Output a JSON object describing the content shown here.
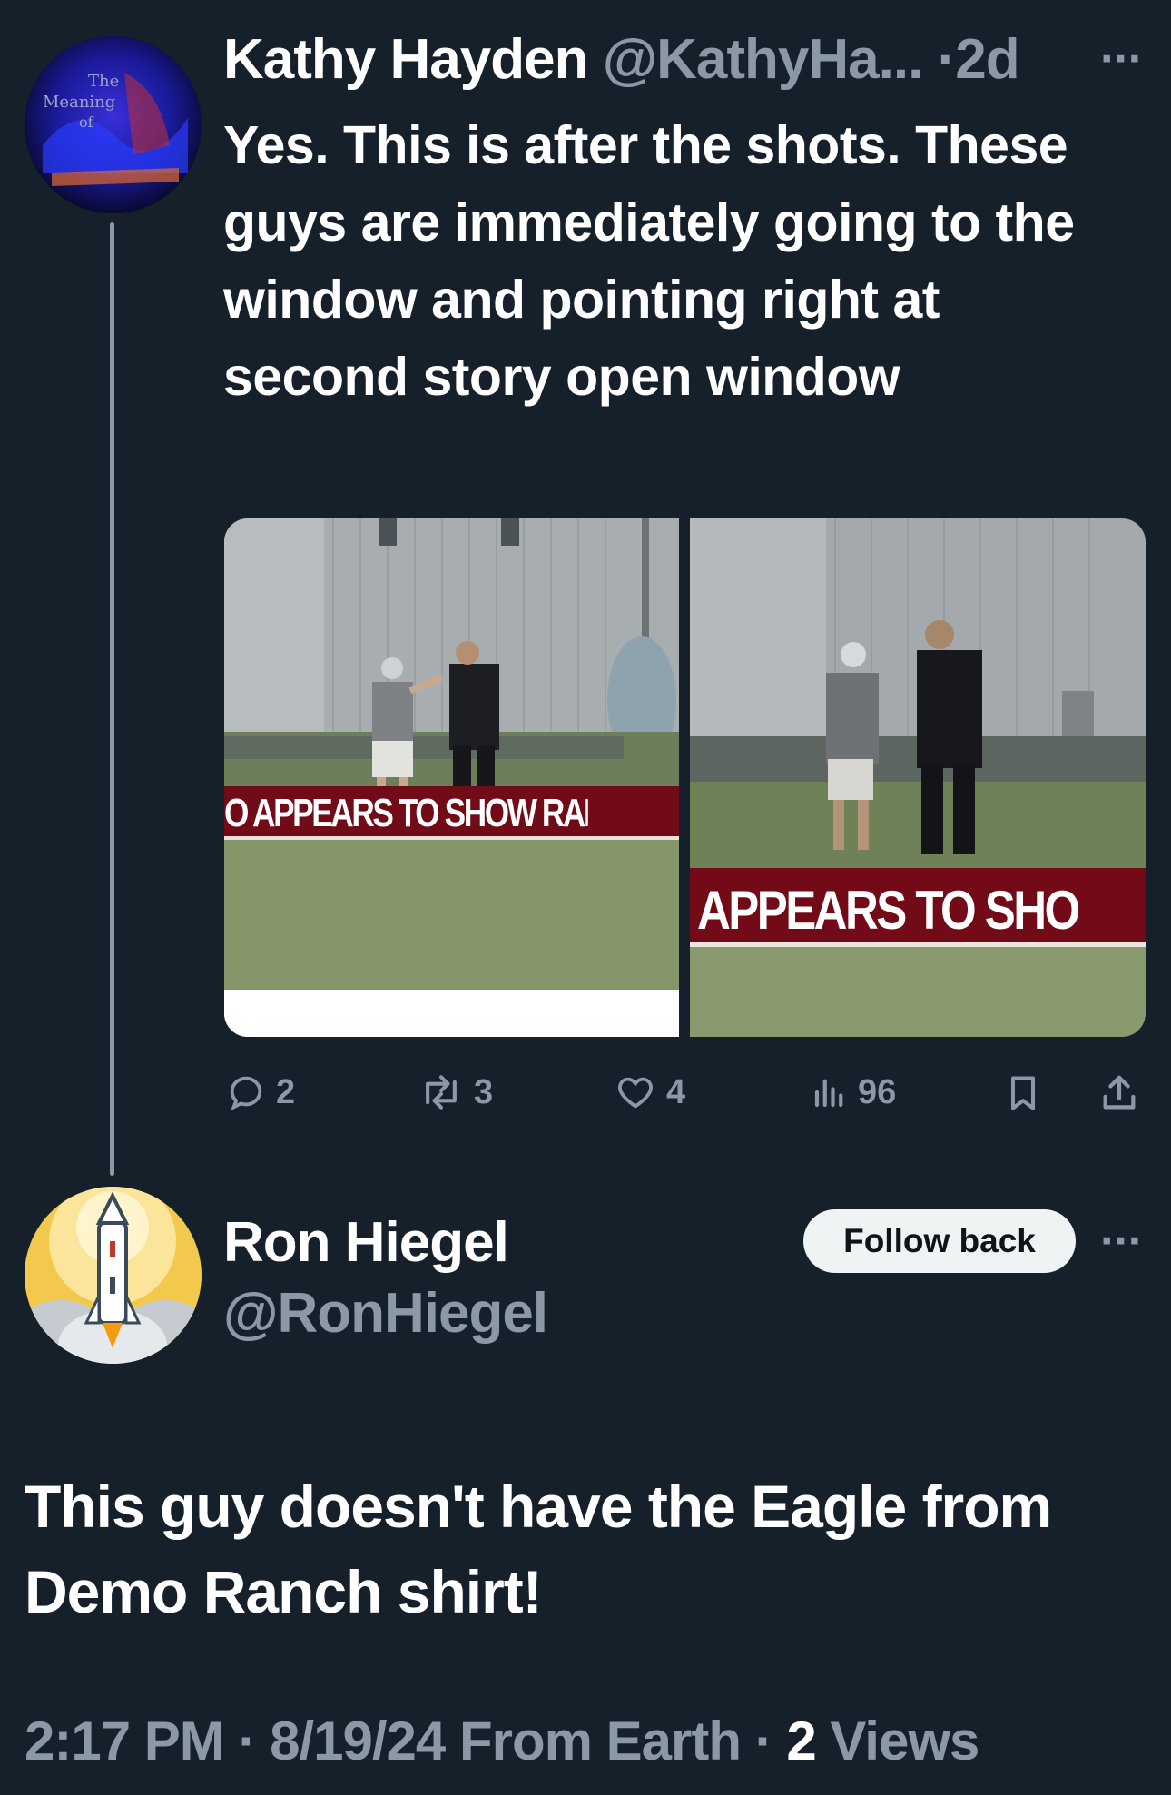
{
  "tweet1": {
    "author_name": "Kathy Hayden",
    "author_handle": "@KathyHa...",
    "separator": "·",
    "age": "2d",
    "more": "···",
    "text": "Yes. This is after the shots. These guys are immediately going to the window and pointing right at second story open window",
    "media": {
      "left_caption": "O APPEARS TO SHOW RALLY G",
      "right_caption": "APPEARS TO SHOW RA"
    },
    "actions": {
      "replies": "2",
      "reposts": "3",
      "likes": "4",
      "views": "96"
    }
  },
  "tweet2": {
    "author_name": "Ron Hiegel",
    "author_handle": "@RonHiegel",
    "follow_label": "Follow back",
    "more": "···",
    "text": "This guy doesn't have the Eagle from Demo Ranch shirt!",
    "footer": {
      "time": "2:17 PM",
      "date": "8/19/24",
      "source": "From Earth",
      "views_count": "2",
      "views_label": "Views",
      "dot": "·"
    }
  },
  "icons": {
    "reply": "reply-icon",
    "repost": "repost-icon",
    "like": "heart-icon",
    "views": "views-icon",
    "bookmark": "bookmark-icon",
    "share": "share-icon"
  },
  "colors": {
    "background": "#15202b",
    "muted": "#8b98a5",
    "text": "#ffffff",
    "follow_button": "#eff3f4"
  }
}
